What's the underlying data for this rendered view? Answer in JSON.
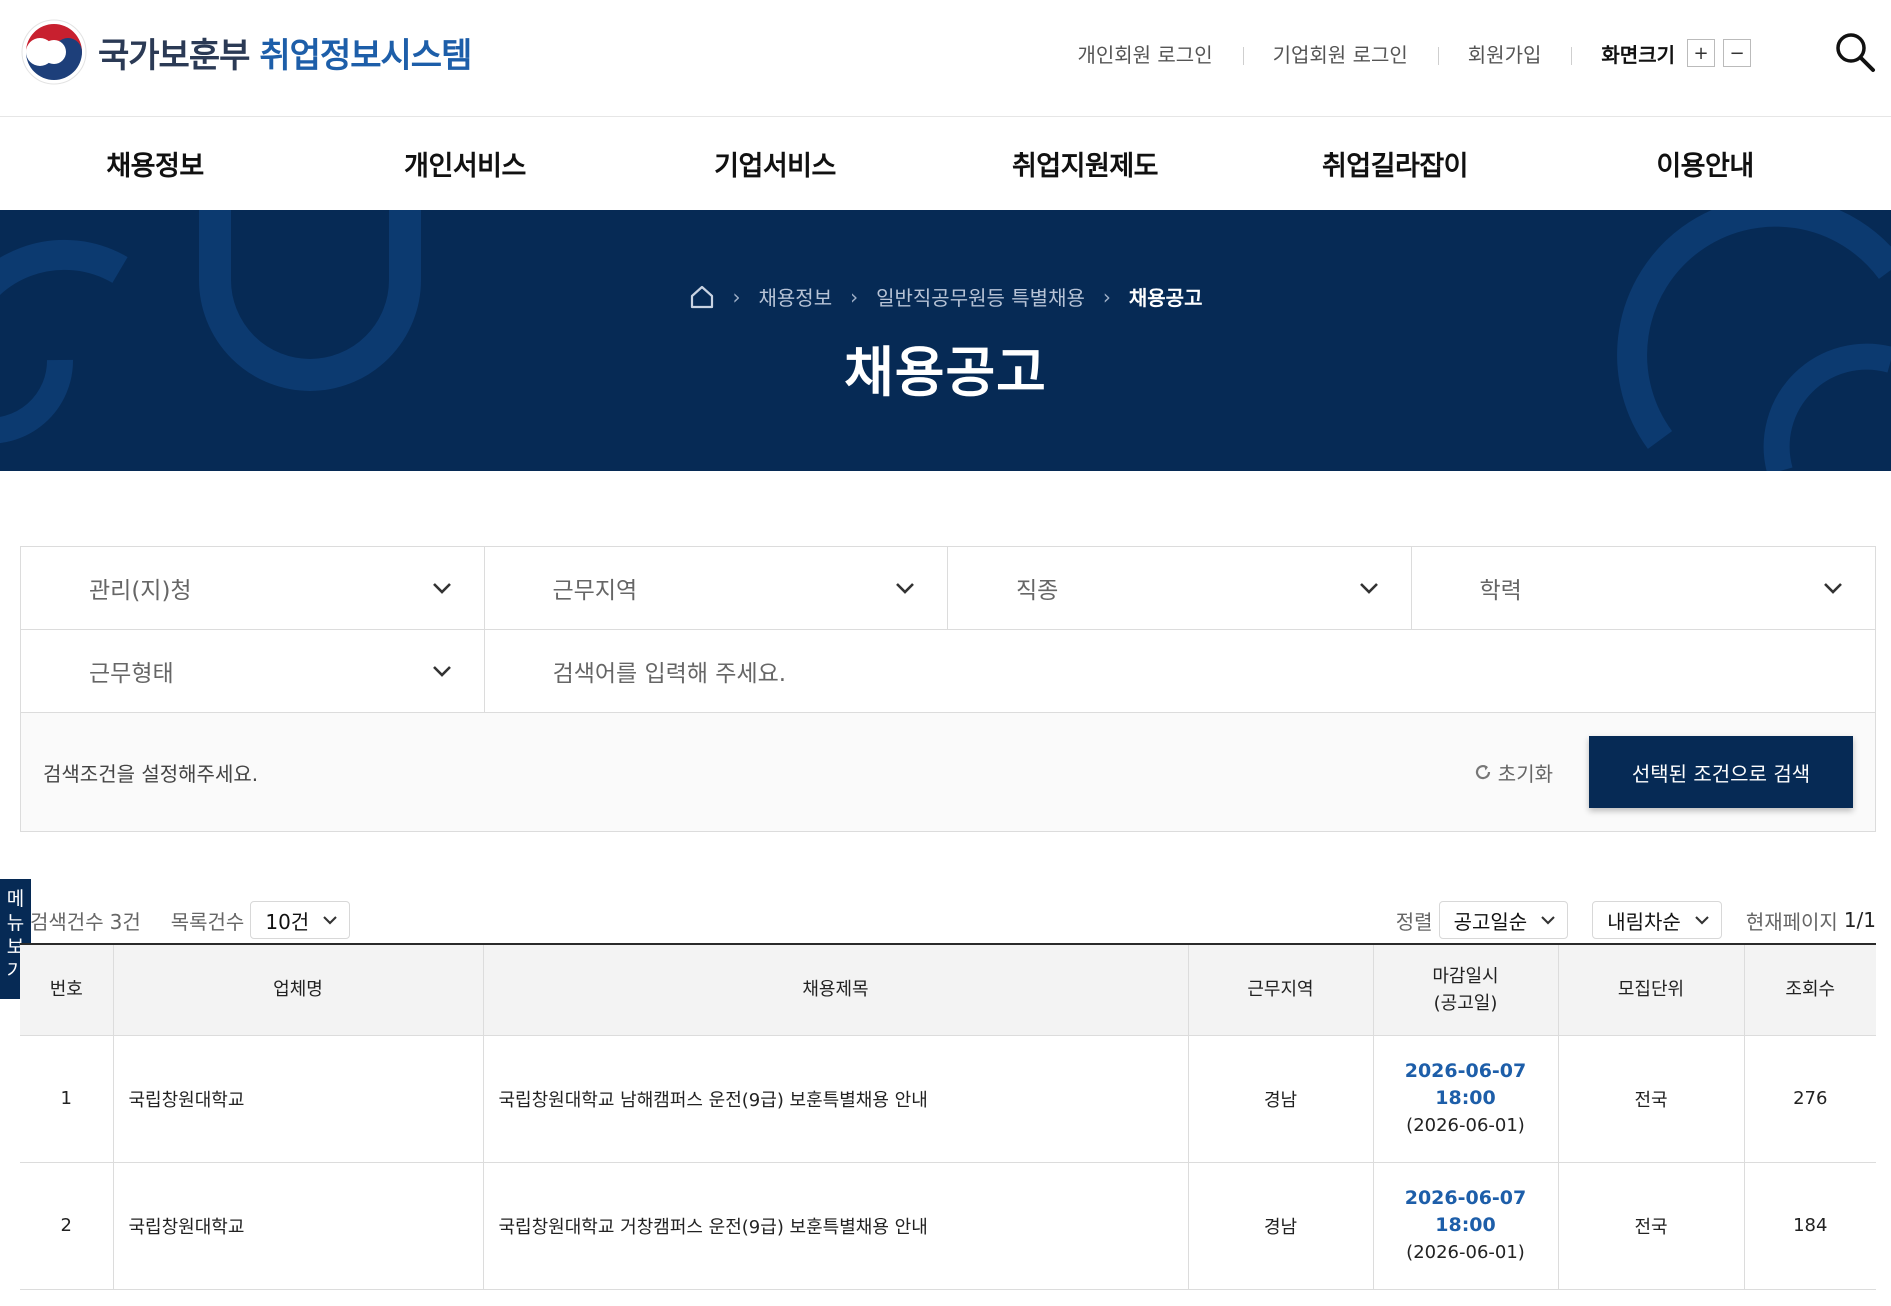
{
  "header": {
    "logo_text_a": "국가보훈부",
    "logo_text_b": "취업정보시스템",
    "util_links": [
      "개인회원 로그인",
      "기업회원 로그인",
      "회원가입"
    ],
    "zoom_label": "화면크기",
    "zoom_in": "+",
    "zoom_out": "−"
  },
  "gnb": [
    "채용정보",
    "개인서비스",
    "기업서비스",
    "취업지원제도",
    "취업길라잡이",
    "이용안내"
  ],
  "banner": {
    "breadcrumb": [
      "채용정보",
      "일반직공무원등 특별채용",
      "채용공고"
    ],
    "title": "채용공고"
  },
  "filters": {
    "row1": [
      "관리(지)청",
      "근무지역",
      "직종",
      "학력"
    ],
    "work_type": "근무형태",
    "keyword_placeholder": "검색어를 입력해 주세요.",
    "hint": "검색조건을 설정해주세요.",
    "reset_label": "초기화",
    "search_button": "선택된 조건으로 검색"
  },
  "side_tab": [
    "메",
    "뉴",
    "보",
    "기"
  ],
  "toolbar": {
    "count_label": "검색건수",
    "count_value": "3건",
    "page_size_label": "목록건수",
    "page_size_value": "10건",
    "sort_label": "정렬",
    "sort_value": "공고일순",
    "order_value": "내림차순",
    "page_label": "현재페이지",
    "page_value": "1/1"
  },
  "table": {
    "headers": [
      "번호",
      "업체명",
      "채용제목",
      "근무지역",
      "마감일시",
      "(공고일)",
      "모집단위",
      "조회수"
    ],
    "rows": [
      {
        "no": "1",
        "company": "국립창원대학교",
        "title": "국립창원대학교 남해캠퍼스 운전(9급) 보훈특별채용 안내",
        "region": "경남",
        "deadline_date": "2026-06-07",
        "deadline_time": "18:00",
        "posted": "(2026-06-01)",
        "unit": "전국",
        "views": "276"
      },
      {
        "no": "2",
        "company": "국립창원대학교",
        "title": "국립창원대학교 거창캠퍼스 운전(9급) 보훈특별채용 안내",
        "region": "경남",
        "deadline_date": "2026-06-07",
        "deadline_time": "18:00",
        "posted": "(2026-06-01)",
        "unit": "전국",
        "views": "184"
      }
    ]
  },
  "colors": {
    "navy": "#062a55",
    "link_blue": "#1d5ea9"
  }
}
